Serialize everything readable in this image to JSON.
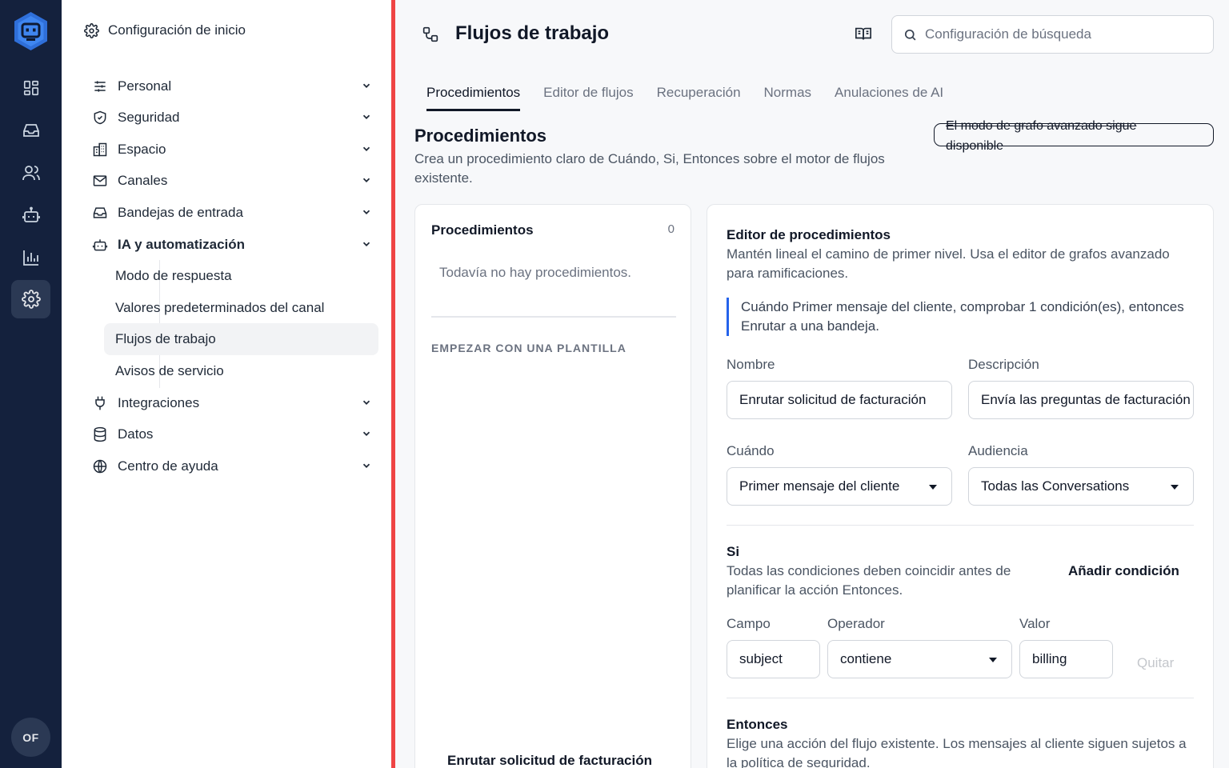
{
  "rail": {
    "items": [
      "dashboard-icon",
      "inbox-icon",
      "contacts-icon",
      "bot-icon",
      "reports-icon",
      "settings-icon"
    ],
    "active": "settings-icon",
    "avatar": "OF"
  },
  "nav": {
    "top": "Configuración de inicio",
    "sections": [
      {
        "label": "Personal",
        "icon": "sliders-icon"
      },
      {
        "label": "Seguridad",
        "icon": "shield-icon"
      },
      {
        "label": "Espacio",
        "icon": "building-icon"
      },
      {
        "label": "Canales",
        "icon": "mail-icon"
      },
      {
        "label": "Bandejas de entrada",
        "icon": "inbox-icon"
      },
      {
        "label": "IA y automatización",
        "icon": "bot-icon"
      },
      {
        "label": "Integraciones",
        "icon": "plug-icon"
      },
      {
        "label": "Datos",
        "icon": "database-icon"
      },
      {
        "label": "Centro de ayuda",
        "icon": "globe-icon"
      }
    ],
    "subitems": [
      "Modo de respuesta",
      "Valores predeterminados del canal",
      "Flujos de trabajo",
      "Avisos de servicio"
    ],
    "active_subitem": "Flujos de trabajo"
  },
  "header": {
    "title": "Flujos de trabajo",
    "search_placeholder": "Configuración de búsqueda"
  },
  "tabs": [
    "Procedimientos",
    "Editor de flujos",
    "Recuperación",
    "Normas",
    "Anulaciones de AI"
  ],
  "active_tab": "Procedimientos",
  "section": {
    "title": "Procedimientos",
    "desc": "Crea un procedimiento claro de Cuándo, Si, Entonces sobre el motor de flujos existente.",
    "notice": "El modo de grafo avanzado sigue disponible"
  },
  "list_card": {
    "title": "Procedimientos",
    "count": "0",
    "empty": "Todavía no hay procedimientos.",
    "template_heading": "EMPEZAR CON UNA PLANTILLA",
    "template_item": "Enrutar solicitud de facturación"
  },
  "editor": {
    "title": "Editor de procedimientos",
    "desc": "Mantén lineal el camino de primer nivel. Usa el editor de grafos avanzado para ramificaciones.",
    "summary": "Cuándo Primer mensaje del cliente, comprobar 1 condición(es), entonces Enrutar a una bandeja.",
    "name_label": "Nombre",
    "name_value": "Enrutar solicitud de facturación",
    "desc_label": "Descripción",
    "desc_value": "Envía las preguntas de facturación",
    "when_label": "Cuándo",
    "when_value": "Primer mensaje del cliente",
    "audience_label": "Audiencia",
    "audience_value": "Todas las Conversations",
    "if_title": "Si",
    "if_desc": "Todas las condiciones deben coincidir antes de planificar la acción Entonces.",
    "add_condition": "Añadir condición",
    "field_label": "Campo",
    "field_value": "subject",
    "operator_label": "Operador",
    "operator_value": "contiene",
    "value_label": "Valor",
    "value_value": "billing",
    "remove": "Quitar",
    "then_title": "Entonces",
    "then_desc": "Elige una acción del flujo existente. Los mensajes al cliente siguen sujetos a la política de seguridad."
  },
  "colors": {
    "rail": "#14213d",
    "accent_blue": "#2563eb",
    "divider_red": "#ef4444"
  }
}
